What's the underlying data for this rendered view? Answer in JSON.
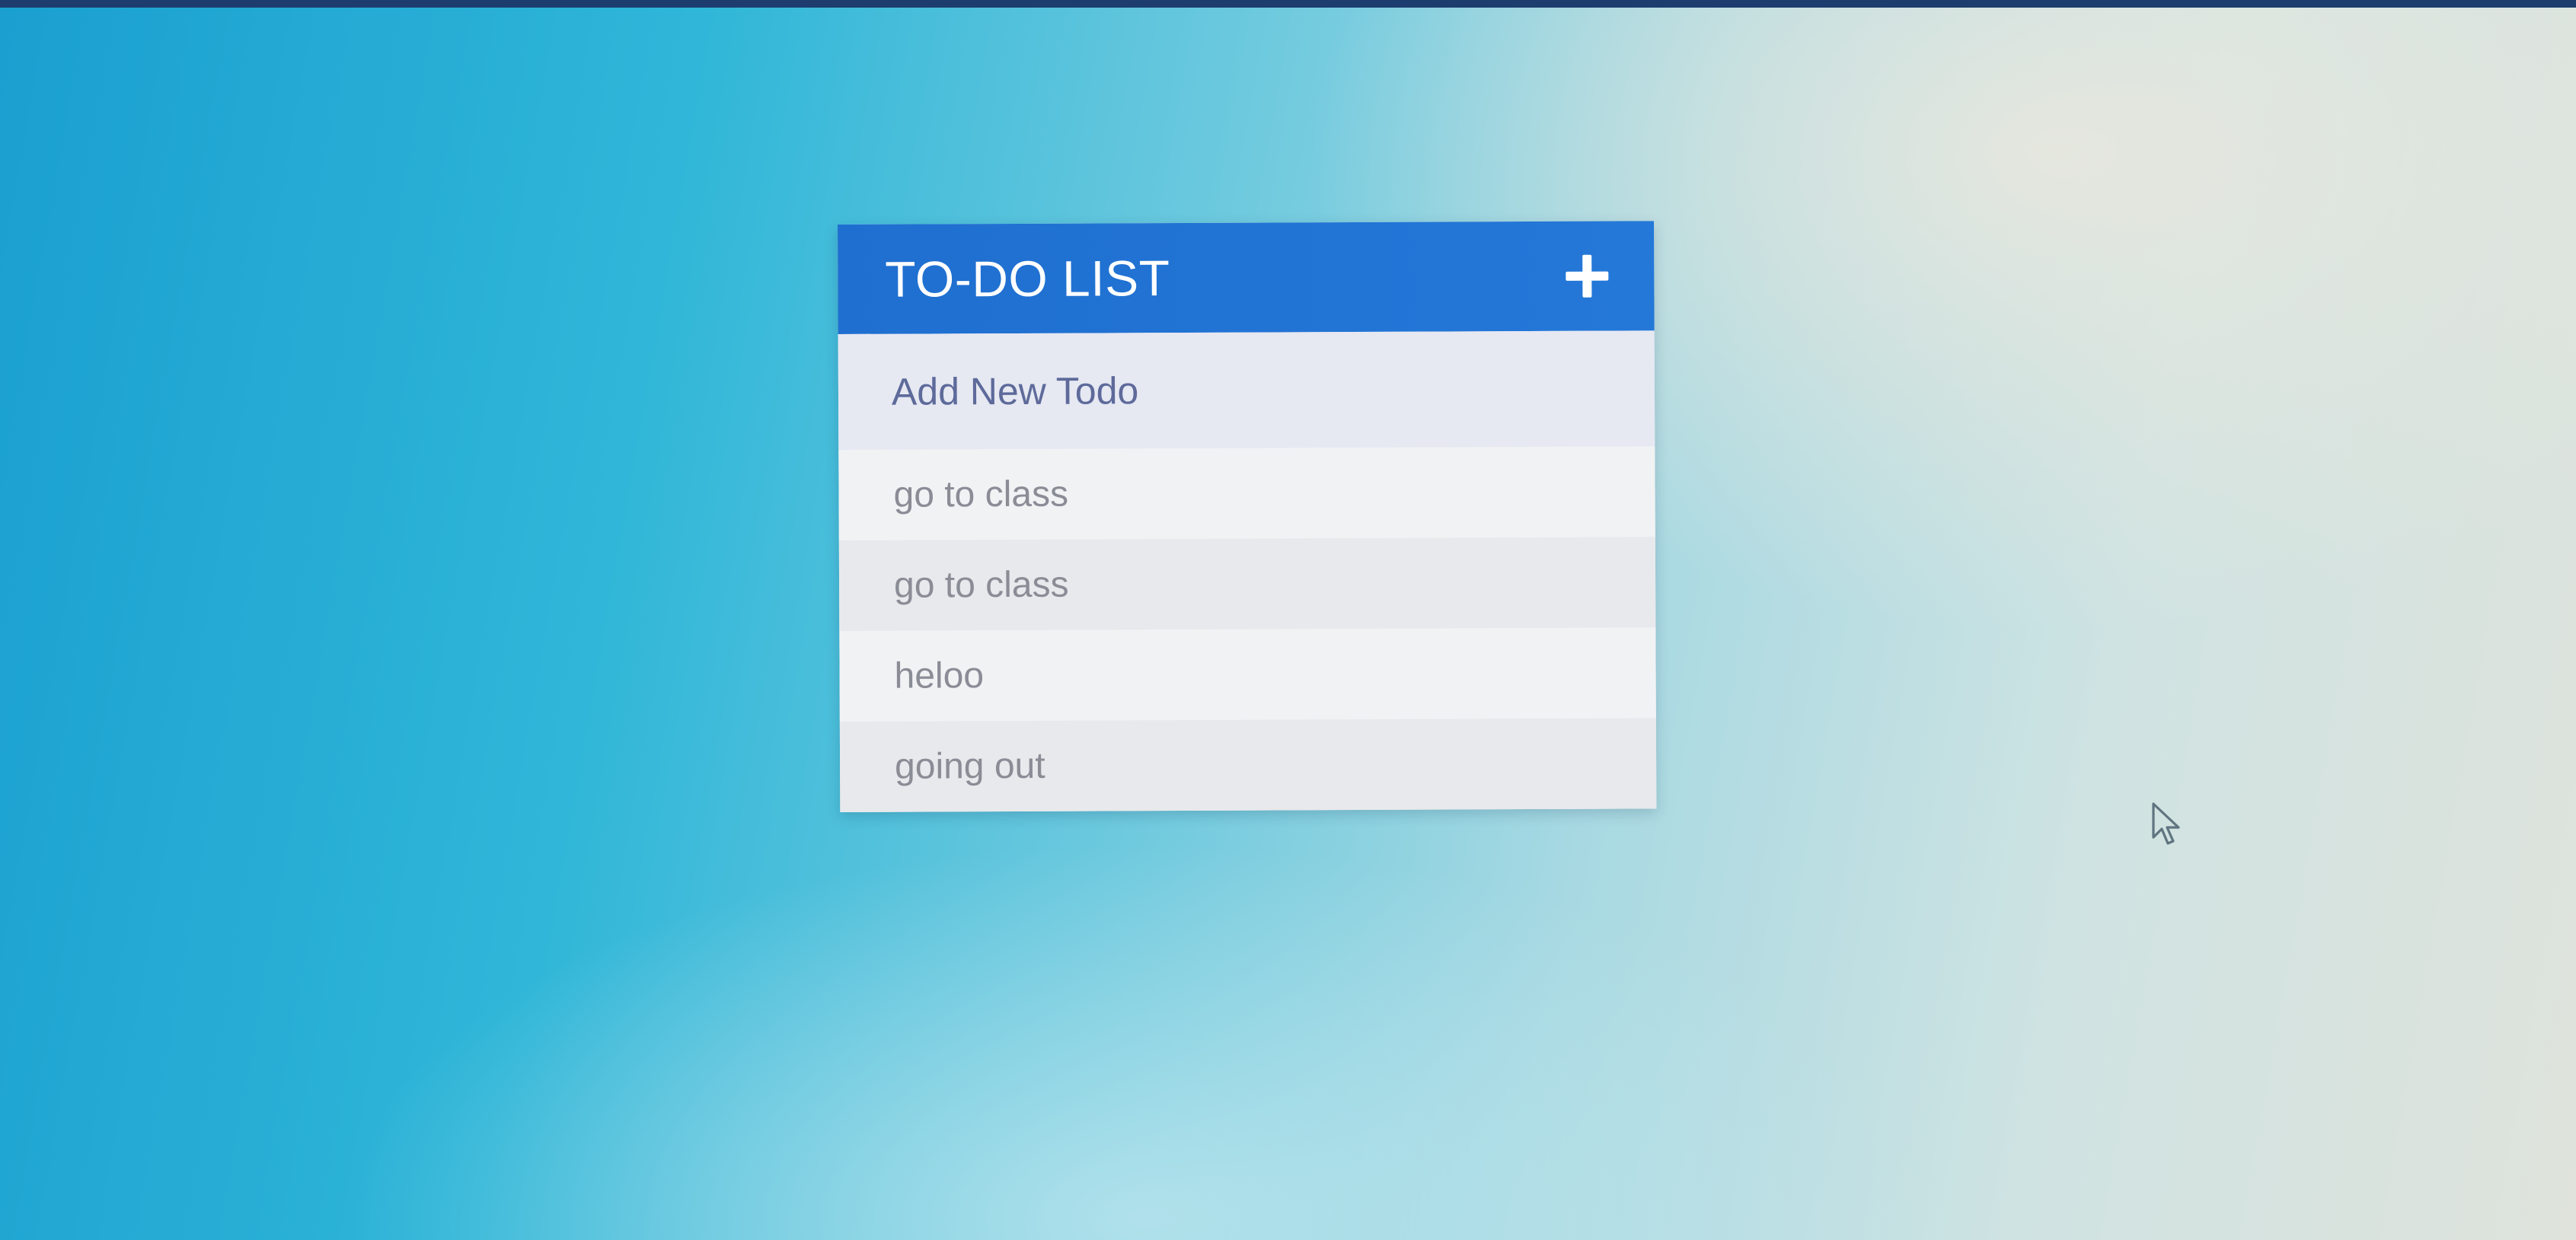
{
  "app": {
    "title": "TO-DO LIST",
    "add_button_icon": "plus-icon"
  },
  "new_todo": {
    "placeholder": "Add New Todo",
    "value": ""
  },
  "todos": [
    {
      "text": "go to class"
    },
    {
      "text": "go to class"
    },
    {
      "text": "heloo"
    },
    {
      "text": "going out"
    }
  ],
  "colors": {
    "header": "#1f6fd0",
    "header_text": "#ffffff",
    "input_bg": "#e6e8f2",
    "input_text": "#5d6a9a",
    "item_text": "#8a8c96"
  },
  "pointer_icon": "mouse-pointer-icon"
}
